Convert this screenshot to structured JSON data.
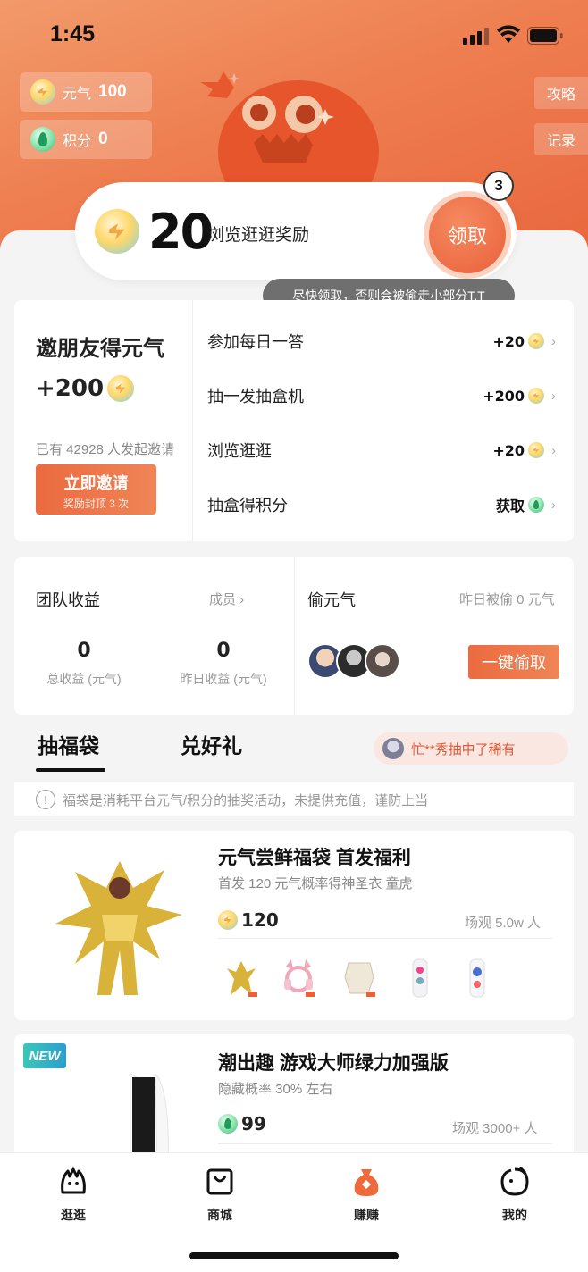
{
  "status_bar": {
    "time": "1:45"
  },
  "header": {
    "yuanqi_label": "元气",
    "yuanqi_value": "100",
    "points_label": "积分",
    "points_value": "0",
    "guide_label": "攻略",
    "records_label": "记录"
  },
  "reward": {
    "amount": "20",
    "description": "浏览逛逛奖励",
    "claim_label": "领取",
    "badge_count": "3",
    "tooltip": "尽快领取，否则会被偷走小部分T.T"
  },
  "invite": {
    "title": "邀朋友得元气",
    "bonus": "+200",
    "count_text": "已有 42928 人发起邀请",
    "button_label": "立即邀请",
    "button_sub": "奖励封顶 3 次"
  },
  "tasks": [
    {
      "name": "参加每日一答",
      "value": "+20",
      "icon": "coin-icon"
    },
    {
      "name": "抽一发抽盒机",
      "value": "+200",
      "icon": "coin-icon"
    },
    {
      "name": "浏览逛逛",
      "value": "+20",
      "icon": "coin-icon"
    },
    {
      "name": "抽盒得积分",
      "value": "获取",
      "icon": "gem-icon"
    }
  ],
  "team": {
    "title": "团队收益",
    "members_link": "成员 ›",
    "total_value": "0",
    "total_label": "总收益 (元气)",
    "yesterday_value": "0",
    "yesterday_label": "昨日收益 (元气)"
  },
  "steal": {
    "title": "偷元气",
    "yesterday_text": "昨日被偷 0 元气",
    "button_label": "一键偷取"
  },
  "tabs": {
    "lucky_bag": "抽福袋",
    "redeem": "兑好礼"
  },
  "winner_text": "忙**秀抽中了稀有",
  "notice": "福袋是消耗平台元气/积分的抽奖活动，未提供充值，谨防上当",
  "products": [
    {
      "title": "元气尝鲜福袋 首发福利",
      "subtitle": "首发 120 元气概率得神圣衣 童虎",
      "price": "120",
      "watchers": "场观 5.0w 人"
    },
    {
      "title": "潮出趣 游戏大师绿力加强版",
      "subtitle": "隐藏概率 30% 左右",
      "price": "99",
      "watchers": "场观 3000+ 人",
      "tag": "NEW"
    }
  ],
  "nav": [
    {
      "label": "逛逛",
      "icon": "explore-icon"
    },
    {
      "label": "商城",
      "icon": "shop-bag-icon"
    },
    {
      "label": "赚赚",
      "icon": "earn-bag-icon"
    },
    {
      "label": "我的",
      "icon": "profile-icon"
    }
  ],
  "colors": {
    "accent": "#ee7048",
    "hero_top": "#f29a6a",
    "hero_bottom": "#e9663d",
    "winner_text": "#e25a35"
  }
}
